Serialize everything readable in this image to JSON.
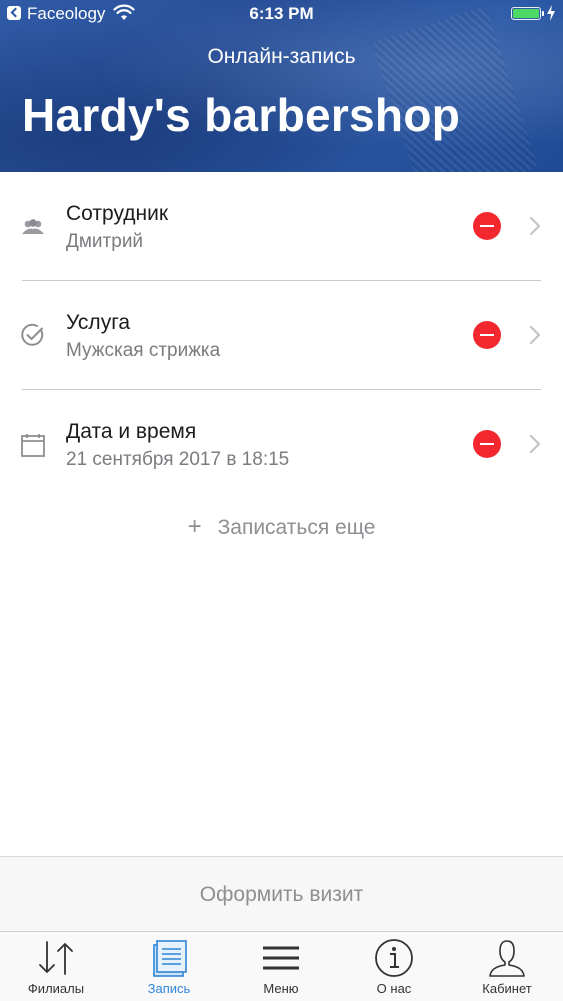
{
  "status_bar": {
    "app_name": "Faceology",
    "time": "6:13 PM"
  },
  "header": {
    "subtitle": "Онлайн-запись",
    "title": "Hardy's barbershop"
  },
  "booking_rows": [
    {
      "title": "Сотрудник",
      "value": "Дмитрий",
      "icon": "staff-icon"
    },
    {
      "title": "Услуга",
      "value": "Мужская стрижка",
      "icon": "checkmark-circle-icon"
    },
    {
      "title": "Дата и время",
      "value": "21 сентября 2017 в 18:15",
      "icon": "calendar-icon"
    }
  ],
  "add_more": {
    "plus": "+",
    "label": "Записаться еще"
  },
  "submit": {
    "label": "Оформить визит"
  },
  "tabs": [
    {
      "label": "Филиалы",
      "icon": "arrows-up-down-icon",
      "active": false
    },
    {
      "label": "Запись",
      "icon": "document-list-icon",
      "active": true
    },
    {
      "label": "Меню",
      "icon": "hamburger-menu-icon",
      "active": false
    },
    {
      "label": "О нас",
      "icon": "info-circle-icon",
      "active": false
    },
    {
      "label": "Кабинет",
      "icon": "user-profile-icon",
      "active": false
    }
  ],
  "colors": {
    "header_blue": "#2a58a6",
    "remove_red": "#f2282e",
    "active_tab_blue": "#2f86d8",
    "battery_green": "#4cd964"
  }
}
